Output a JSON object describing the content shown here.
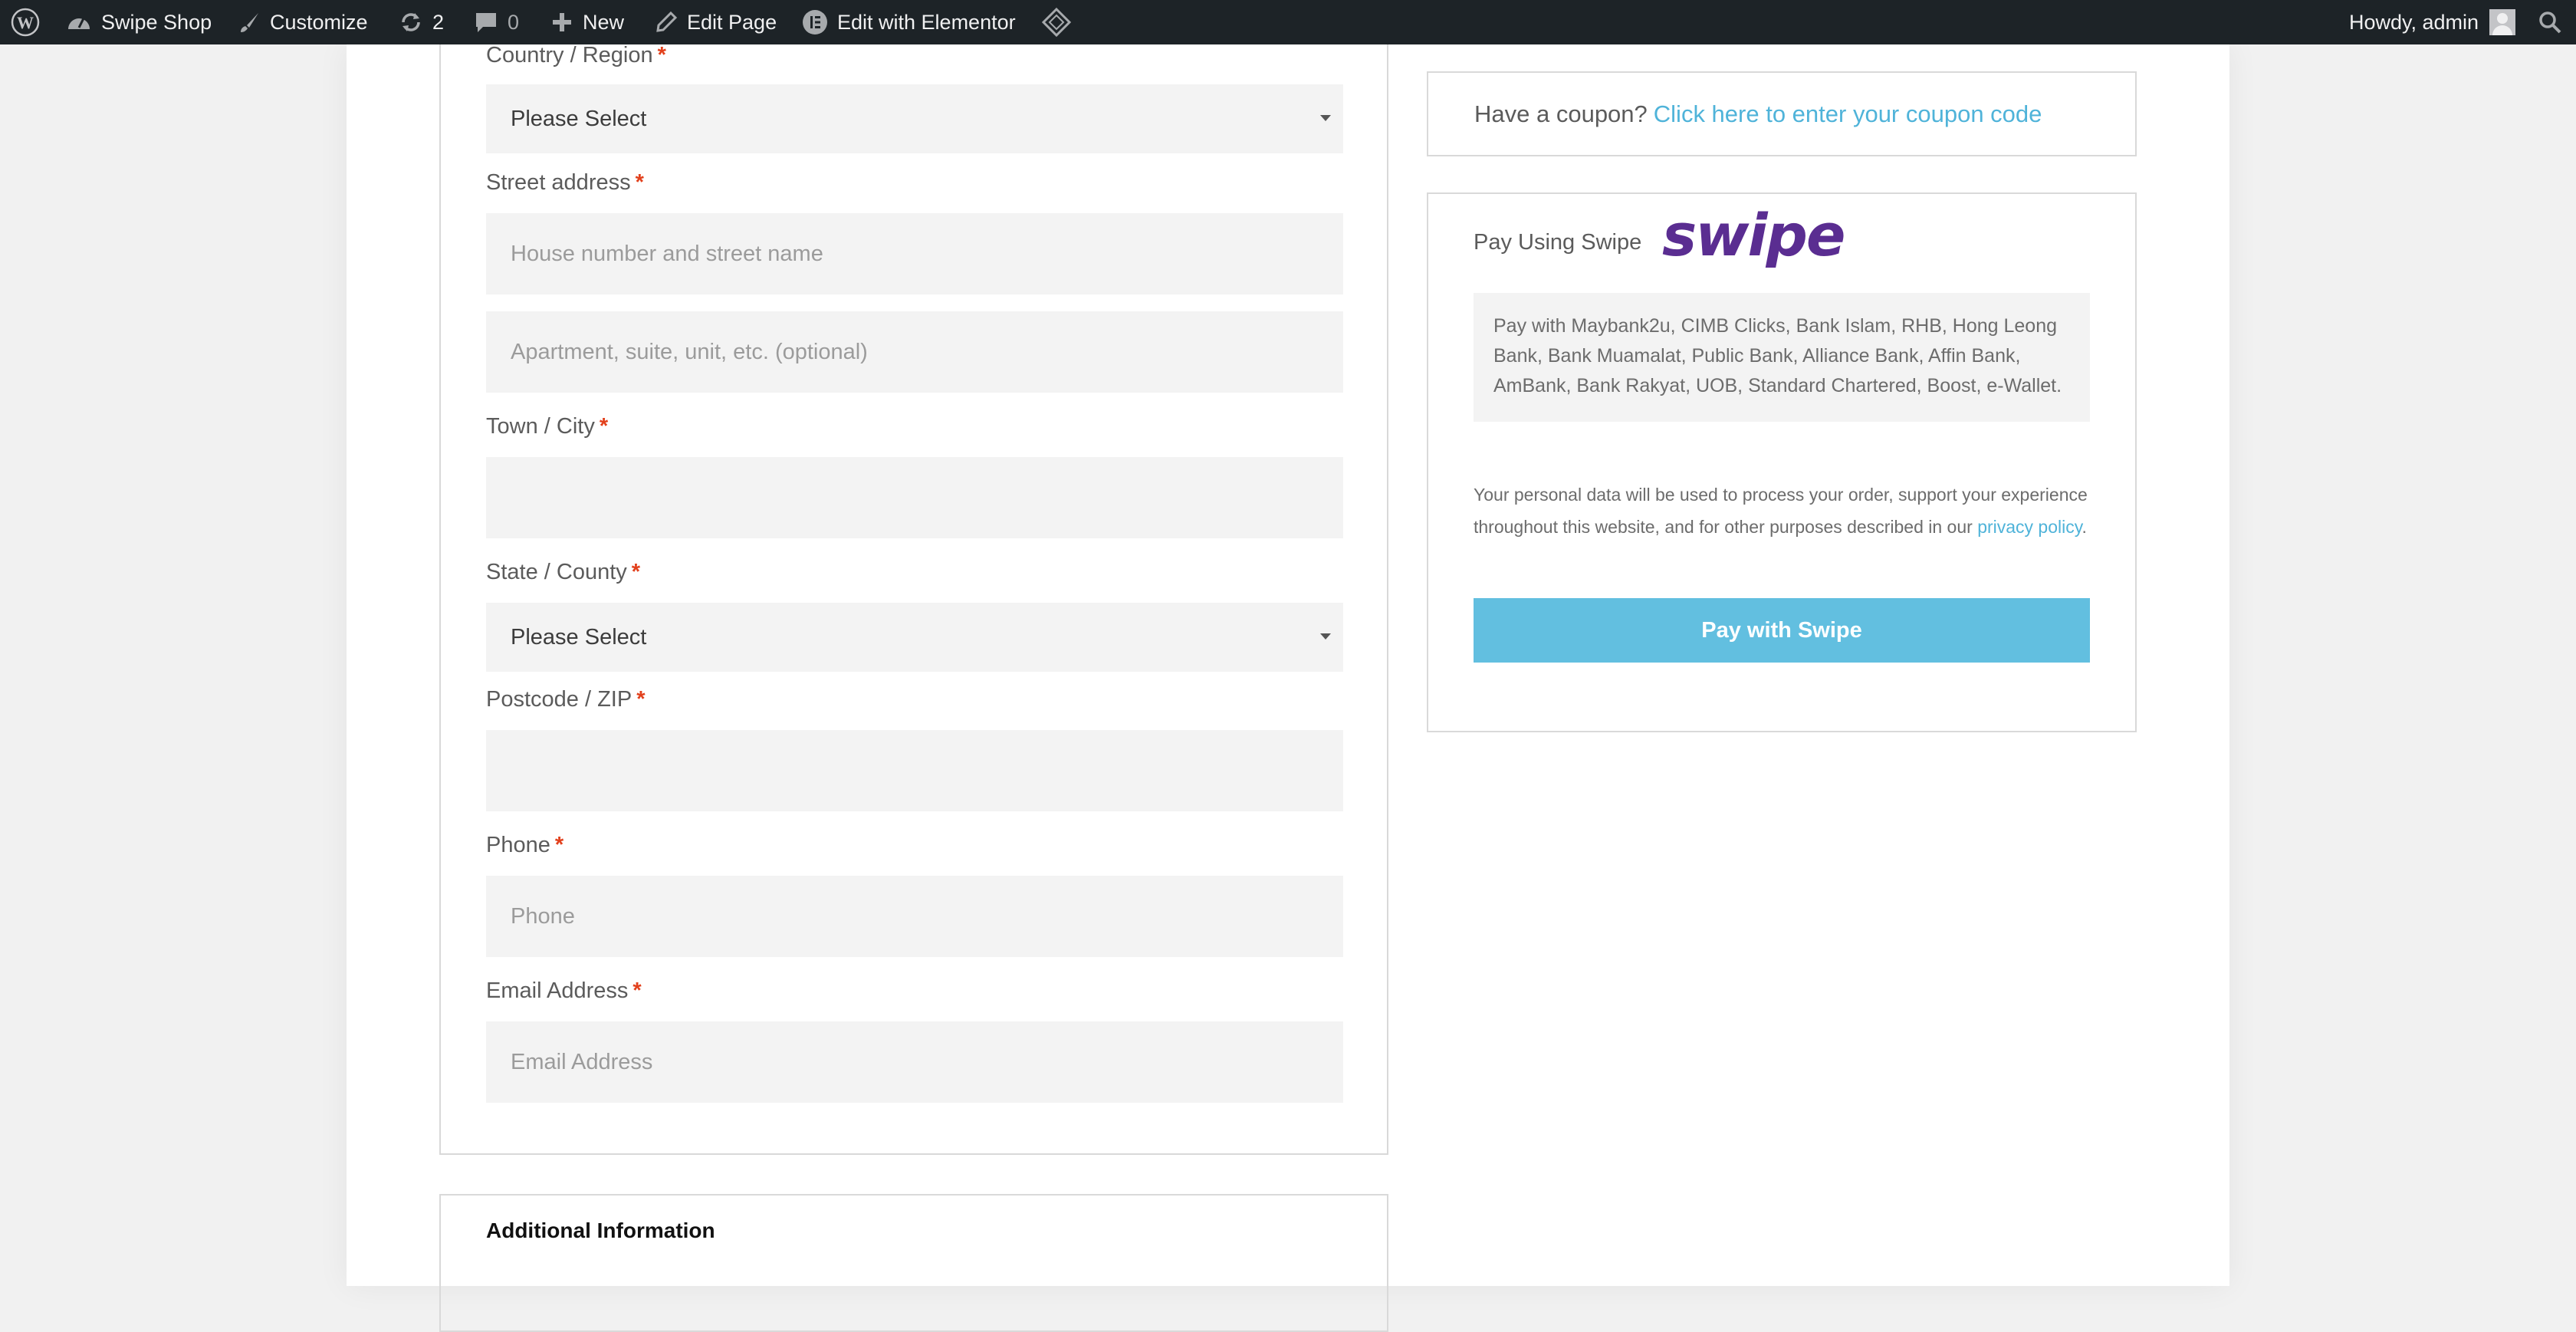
{
  "admin_bar": {
    "site_name": "Swipe Shop",
    "customize": "Customize",
    "updates_count": "2",
    "comments_count": "0",
    "new_label": "New",
    "edit_page": "Edit Page",
    "edit_elementor": "Edit with Elementor",
    "howdy": "Howdy, admin",
    "icons": [
      "wordpress-icon",
      "dashboard-icon",
      "brush-icon",
      "updates-icon",
      "comment-icon",
      "plus-icon",
      "pencil-icon",
      "elementor-icon",
      "diamond-icon",
      "search-icon"
    ]
  },
  "billing": {
    "country": {
      "label": "Country / Region",
      "required": "*",
      "value": "Please Select"
    },
    "street": {
      "label": "Street address",
      "required": "*",
      "placeholder1": "House number and street name",
      "placeholder2": "Apartment, suite, unit, etc. (optional)"
    },
    "city": {
      "label": "Town / City",
      "required": "*",
      "value": ""
    },
    "state": {
      "label": "State / County",
      "required": "*",
      "value": "Please Select"
    },
    "postcode": {
      "label": "Postcode / ZIP",
      "required": "*",
      "value": ""
    },
    "phone": {
      "label": "Phone",
      "required": "*",
      "placeholder": "Phone"
    },
    "email": {
      "label": "Email Address",
      "required": "*",
      "placeholder": "Email Address"
    }
  },
  "additional_info": {
    "title": "Additional Information"
  },
  "coupon": {
    "prompt": "Have a coupon?",
    "link": "Click here to enter your coupon code"
  },
  "payment": {
    "title": "Pay Using Swipe",
    "logo": "swipe",
    "description": "Pay with Maybank2u, CIMB Clicks, Bank Islam, RHB, Hong Leong Bank, Bank Muamalat, Public Bank, Alliance Bank, Affin Bank, AmBank, Bank Rakyat, UOB, Standard Chartered, Boost, e-Wallet.",
    "privacy_text": "Your personal data will be used to process your order, support your experience throughout this website, and for other purposes described in our",
    "privacy_link": "privacy policy",
    "privacy_end": ".",
    "button": "Pay with Swipe"
  },
  "colors": {
    "accent": "#62bfe0",
    "link": "#4fb3d9",
    "brand": "#5a2d91",
    "required": "#e2401c",
    "adminbar": "#1d2327"
  }
}
